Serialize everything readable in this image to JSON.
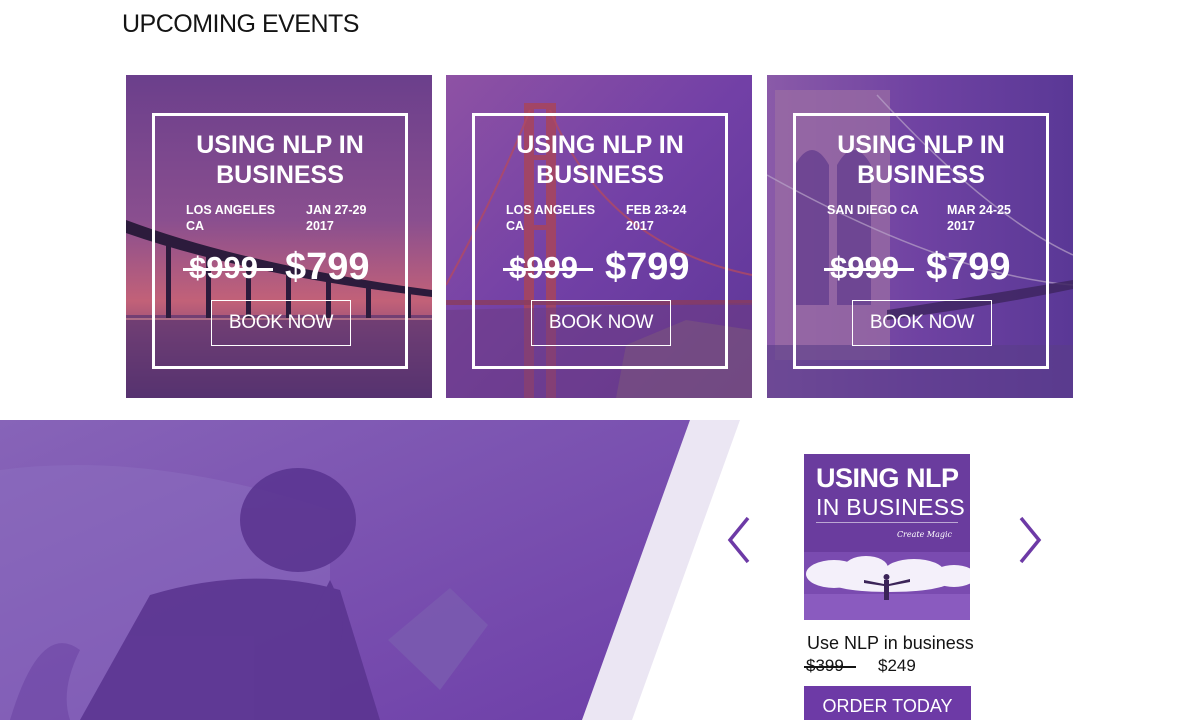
{
  "section": {
    "title": "UPCOMING EVENTS"
  },
  "events": [
    {
      "title": "USING NLP IN BUSINESS",
      "city": "LOS ANGELES CA",
      "date": "JAN 27-29 2017",
      "old_price": "$999",
      "new_price": "$799",
      "button": "BOOK NOW"
    },
    {
      "title": "USING NLP IN BUSINESS",
      "city": "LOS ANGELES CA",
      "date": "FEB 23-24 2017",
      "old_price": "$999",
      "new_price": "$799",
      "button": "BOOK NOW"
    },
    {
      "title": "USING NLP IN BUSINESS",
      "city": "SAN DIEGO CA",
      "date": "MAR 24-25 2017",
      "old_price": "$999",
      "new_price": "$799",
      "button": "BOOK NOW"
    }
  ],
  "product": {
    "cover_line1": "USING NLP",
    "cover_line2": "IN BUSINESS",
    "cover_tagline": "Create Magic",
    "name": "Use NLP in business",
    "old_price": "$399",
    "new_price": "$249",
    "button": "ORDER TODAY"
  },
  "carousel": {
    "prev_icon": "chevron-left-icon",
    "next_icon": "chevron-right-icon"
  },
  "colors": {
    "purple": "#6d3aa6",
    "light_purple": "#ece8f4",
    "text": "#141414"
  }
}
